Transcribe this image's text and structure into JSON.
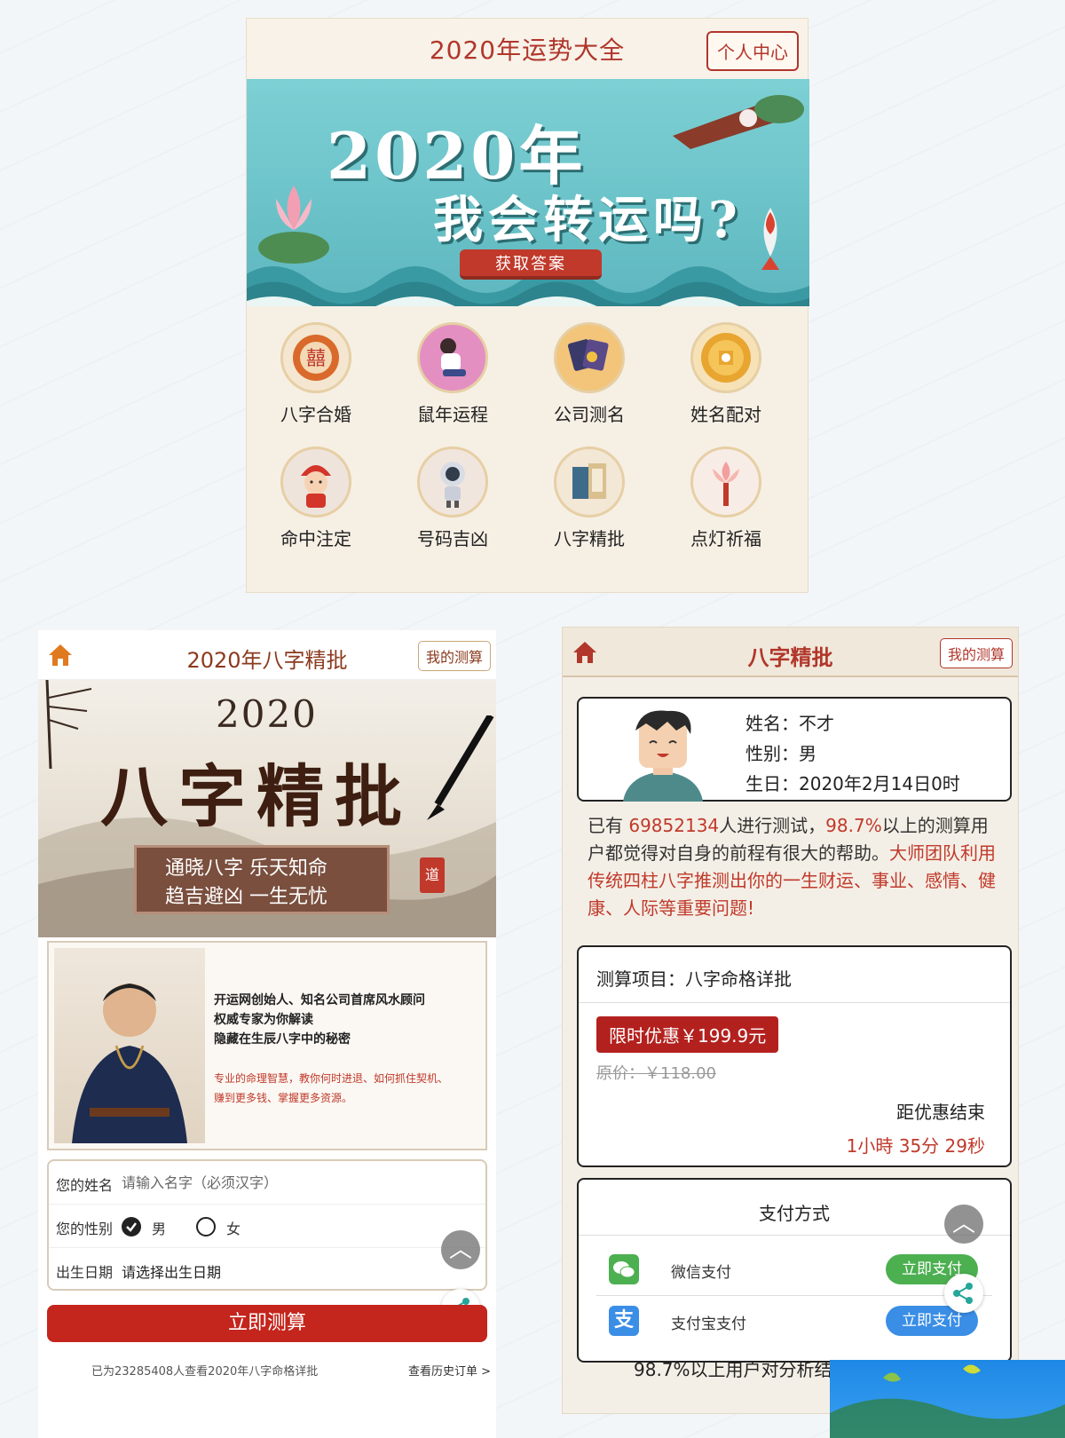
{
  "top": {
    "title": "2020年运势大全",
    "personal_center": "个人中心",
    "banner": {
      "line1": "2020年",
      "line2": "我会转运吗?",
      "button": "获取答案"
    },
    "grid": [
      {
        "label": "八字合婚",
        "icon": "double-happiness-icon"
      },
      {
        "label": "鼠年运程",
        "icon": "sitting-person-icon"
      },
      {
        "label": "公司测名",
        "icon": "cards-icon"
      },
      {
        "label": "姓名配对",
        "icon": "golden-coin-icon"
      },
      {
        "label": "命中注定",
        "icon": "bride-icon"
      },
      {
        "label": "号码吉凶",
        "icon": "astronaut-icon"
      },
      {
        "label": "八字精批",
        "icon": "books-icon"
      },
      {
        "label": "点灯祈福",
        "icon": "lotus-lamp-icon"
      }
    ]
  },
  "left": {
    "title": "2020年八字精批",
    "my_test": "我的测算",
    "banner": {
      "year": "2020",
      "calligraphy": "八字精批",
      "slogan1": "通晓八字 乐天知命",
      "slogan2": "趋吉避凶 一生无忧",
      "seal": "道"
    },
    "master": {
      "line1": "开运网创始人、知名公司首席风水顾问",
      "line2": "权威专家为你解读",
      "line3": "隐藏在生辰八字中的秘密",
      "red1": "专业的命理智慧，教你何时进退、如何抓住契机、",
      "red2": "赚到更多钱、掌握更多资源。"
    },
    "form": {
      "name_label": "您的姓名",
      "name_placeholder": "请输入名字（必须汉字）",
      "gender_label": "您的性别",
      "gender_male": "男",
      "gender_female": "女",
      "selected_gender": "男",
      "birth_label": "出生日期",
      "birth_value": "请选择出生日期"
    },
    "submit": "立即测算",
    "footer_left": "已为23285408人查看2020年八字命格详批",
    "footer_right": "查看历史订单 >"
  },
  "right": {
    "title": "八字精批",
    "my_test": "我的测算",
    "profile": {
      "name": "姓名：不才",
      "gender": "性别：男",
      "birthday": "生日：2020年2月14日0时"
    },
    "desc": {
      "p1": "已有 ",
      "count": "69852134",
      "p2": "人进行测试，",
      "pct": "98.7%",
      "p3": "以上的测算用户都觉得对自身的前程有很大的帮助。",
      "p4": "大师团队利用传统四柱八字推测出你的一生财运、事业、感情、健康、人际等重要问题!"
    },
    "item": {
      "label": "测算项目：八字命格详批",
      "discount": "限时优惠￥199.9元",
      "original": "原价：￥118.00",
      "countdown_label": "距优惠结束",
      "countdown": "1小時 35分 29秒"
    },
    "pay": {
      "title": "支付方式",
      "wechat": "微信支付",
      "wechat_btn": "立即支付",
      "alipay": "支付宝支付",
      "alipay_btn": "立即支付"
    },
    "bottom_text": "98.7%以上用户对分析结"
  },
  "colors": {
    "accent_red": "#c0392b",
    "wechat_green": "#4caf50",
    "alipay_blue": "#3a8ee6"
  }
}
